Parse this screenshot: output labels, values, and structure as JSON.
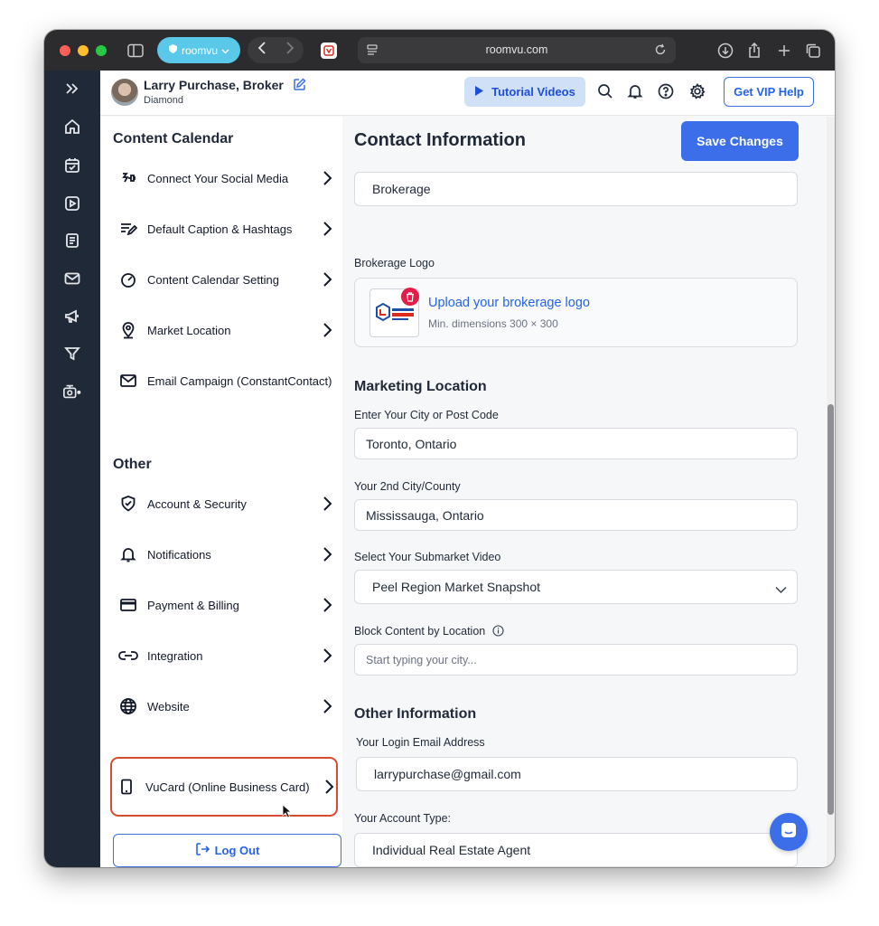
{
  "browser": {
    "tab_label": "roomvu",
    "url": "roomvu.com"
  },
  "header": {
    "user_name": "Larry Purchase, Broker",
    "user_tier": "Diamond",
    "tutorial_label": "Tutorial Videos",
    "vip_label": "Get VIP Help"
  },
  "sidebar": {
    "content_title": "Content Calendar",
    "content_items": [
      {
        "label": "Connect Your Social Media",
        "icon": "plug-icon"
      },
      {
        "label": "Default Caption & Hashtags",
        "icon": "caption-icon"
      },
      {
        "label": "Content Calendar Setting",
        "icon": "gauge-icon"
      },
      {
        "label": "Market Location",
        "icon": "location-pin-icon"
      },
      {
        "label": "Email Campaign (ConstantContact)",
        "icon": "mail-icon"
      }
    ],
    "other_title": "Other",
    "other_items": [
      {
        "label": "Account & Security",
        "icon": "shield-icon"
      },
      {
        "label": "Notifications",
        "icon": "bell-icon"
      },
      {
        "label": "Payment & Billing",
        "icon": "credit-card-icon"
      },
      {
        "label": "Integration",
        "icon": "link-icon"
      },
      {
        "label": "Website",
        "icon": "globe-icon"
      },
      {
        "label": "VuCard (Online Business Card)",
        "icon": "phone-icon"
      }
    ],
    "logout_label": "Log Out"
  },
  "main": {
    "title": "Contact Information",
    "save_label": "Save Changes",
    "brokerage_value": "Brokerage",
    "brokerage_logo_label": "Brokerage Logo",
    "upload_label": "Upload your brokerage logo",
    "upload_hint": "Min. dimensions 300 × 300",
    "logo_text": "LARRY PURCHASE",
    "marketing_title": "Marketing Location",
    "city_label": "Enter Your City or Post Code",
    "city_value": "Toronto, Ontario",
    "city2_label": "Your 2nd City/County",
    "city2_value": "Mississauga, Ontario",
    "submarket_label": "Select Your Submarket Video",
    "submarket_value": "Peel Region Market Snapshot",
    "block_label": "Block Content by Location",
    "block_placeholder": "Start typing your city...",
    "other_info_title": "Other Information",
    "email_label": "Your Login Email Address",
    "email_value": "larrypurchase@gmail.com",
    "account_type_label": "Your Account Type:",
    "account_type_value": "Individual Real Estate Agent"
  }
}
